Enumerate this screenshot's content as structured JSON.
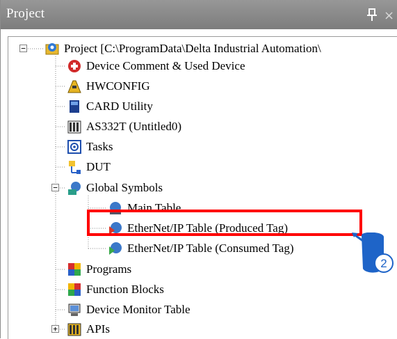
{
  "panel": {
    "title": "Project"
  },
  "tree": {
    "root": "Project [C:\\ProgramData\\Delta Industrial Automation\\",
    "items": [
      "Device Comment & Used Device",
      "HWCONFIG",
      "CARD Utility",
      "AS332T  (Untitled0)",
      "Tasks",
      "DUT",
      "Global Symbols",
      "Main Table",
      "EtherNet/IP Table (Produced Tag)",
      "EtherNet/IP Table (Consumed Tag)",
      "Programs",
      "Function Blocks",
      "Device Monitor Table",
      "APIs"
    ]
  },
  "callout": {
    "step": "2",
    "color": "#1e64c8"
  },
  "highlight_color": "#ff0000",
  "expanders": {
    "root": "−",
    "global_symbols": "−",
    "apis": "+"
  }
}
